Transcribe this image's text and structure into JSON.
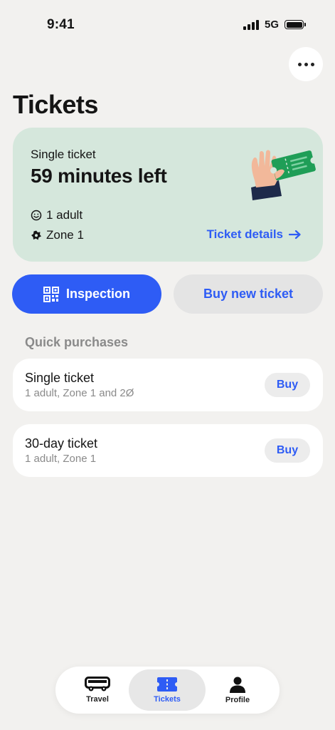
{
  "status_bar": {
    "time": "9:41",
    "network": "5G"
  },
  "header": {
    "title": "Tickets",
    "more_icon": "ellipsis-icon"
  },
  "active_ticket": {
    "type": "Single ticket",
    "time_left": "59 minutes left",
    "passengers": "1 adult",
    "zone": "Zone 1",
    "details_link": "Ticket details",
    "background": "#d5e7dc"
  },
  "actions": {
    "inspection_label": "Inspection",
    "buy_new_label": "Buy new ticket"
  },
  "quick_purchases": {
    "heading": "Quick purchases",
    "items": [
      {
        "title": "Single ticket",
        "subtitle": "1 adult, Zone 1 and 2Ø",
        "button": "Buy"
      },
      {
        "title": "30-day ticket",
        "subtitle": "1 adult, Zone 1",
        "button": "Buy"
      }
    ]
  },
  "tab_bar": {
    "tabs": [
      {
        "label": "Travel",
        "icon": "bus-icon",
        "active": false
      },
      {
        "label": "Tickets",
        "icon": "ticket-icon",
        "active": true
      },
      {
        "label": "Profile",
        "icon": "person-icon",
        "active": false
      }
    ]
  },
  "colors": {
    "accent": "#2e5cf5",
    "background": "#f2f1ef",
    "ticket_card": "#d5e7dc"
  }
}
